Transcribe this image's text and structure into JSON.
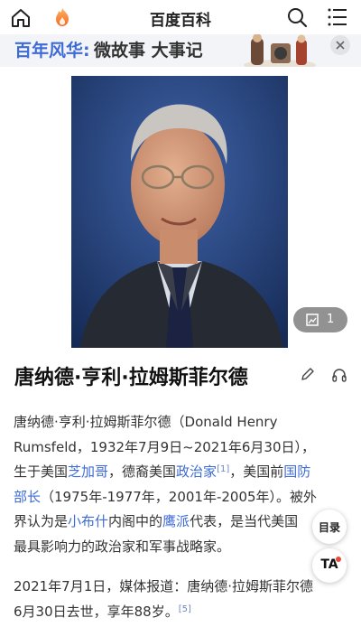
{
  "topbar": {
    "title": "百度百科"
  },
  "banner": {
    "highlight": "百年风华:",
    "text": "微故事 大事记"
  },
  "gallery": {
    "count": "1"
  },
  "entry": {
    "title": "唐纳德·亨利·拉姆斯菲尔德"
  },
  "p1": {
    "l1": "唐纳德·亨利·拉姆斯菲尔德（Donald Henry",
    "l2": "Rumsfeld，1932年7月9日~2021年6月30日），",
    "l3a": "生于美国",
    "l3link": "芝加哥",
    "l3b": "，德裔美国",
    "l3link2": "政治家",
    "l3ref": "[1]",
    "l3c": "，美国前",
    "l3link3": "国防",
    "l4link": "部长",
    "l4b": "（1975年-1977年，2001年-2005年）。被外",
    "l5a": "界认为是",
    "l5link": "小布什",
    "l5b": "内阁中的",
    "l5link2": "鹰派",
    "l5c": "代表，是当代美国",
    "l6": "最具影响力的政治家和军事战略家。"
  },
  "p2": {
    "l1": "2021年7月1日，媒体报道：唐纳德·拉姆斯菲尔德",
    "l2": "6月30日去世，享年88岁。",
    "ref": "[5]"
  },
  "float": {
    "toc": "目录",
    "ta": "TA"
  },
  "colors": {
    "link": "#3e6bd6",
    "banner_bg": "#f3f4f7",
    "ta_dot": "#e64a3b"
  }
}
